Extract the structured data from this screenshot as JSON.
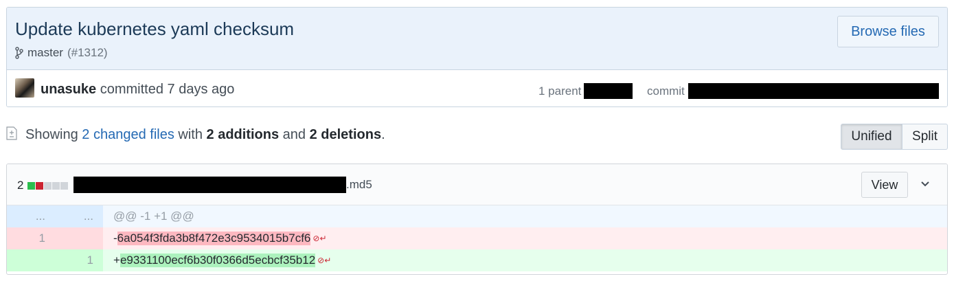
{
  "commit": {
    "title": "Update kubernetes yaml checksum",
    "branch": "master",
    "pr": "(#1312)",
    "browse_label": "Browse files",
    "author": "unasuke",
    "committed_text": "committed 7 days ago",
    "parent_label": "1 parent",
    "commit_label": "commit"
  },
  "summary": {
    "showing": "Showing",
    "changed_files": "2 changed files",
    "with": "with",
    "additions": "2 additions",
    "and": "and",
    "deletions": "2 deletions",
    "period": ".",
    "unified_label": "Unified",
    "split_label": "Split"
  },
  "file": {
    "changes": "2",
    "path_suffix": ".md5",
    "view_label": "View"
  },
  "diff": {
    "hunk_ln1": "...",
    "hunk_ln2": "...",
    "hunk_text": "@@ -1 +1 @@",
    "del_ln": "1",
    "del_prefix": "-",
    "del_text": "6a054f3fda3b8f472e3c9534015b7cf6",
    "add_ln": "1",
    "add_prefix": "+",
    "add_text": "e9331100ecf6b30f0366d5ecbcf35b12"
  },
  "colors": {
    "link": "#2469b3",
    "addition": "#2cbe4e",
    "deletion": "#cb2431"
  },
  "icons": [
    "branch-icon",
    "file-diff-icon",
    "chevron-down-icon",
    "no-newline-icon"
  ]
}
